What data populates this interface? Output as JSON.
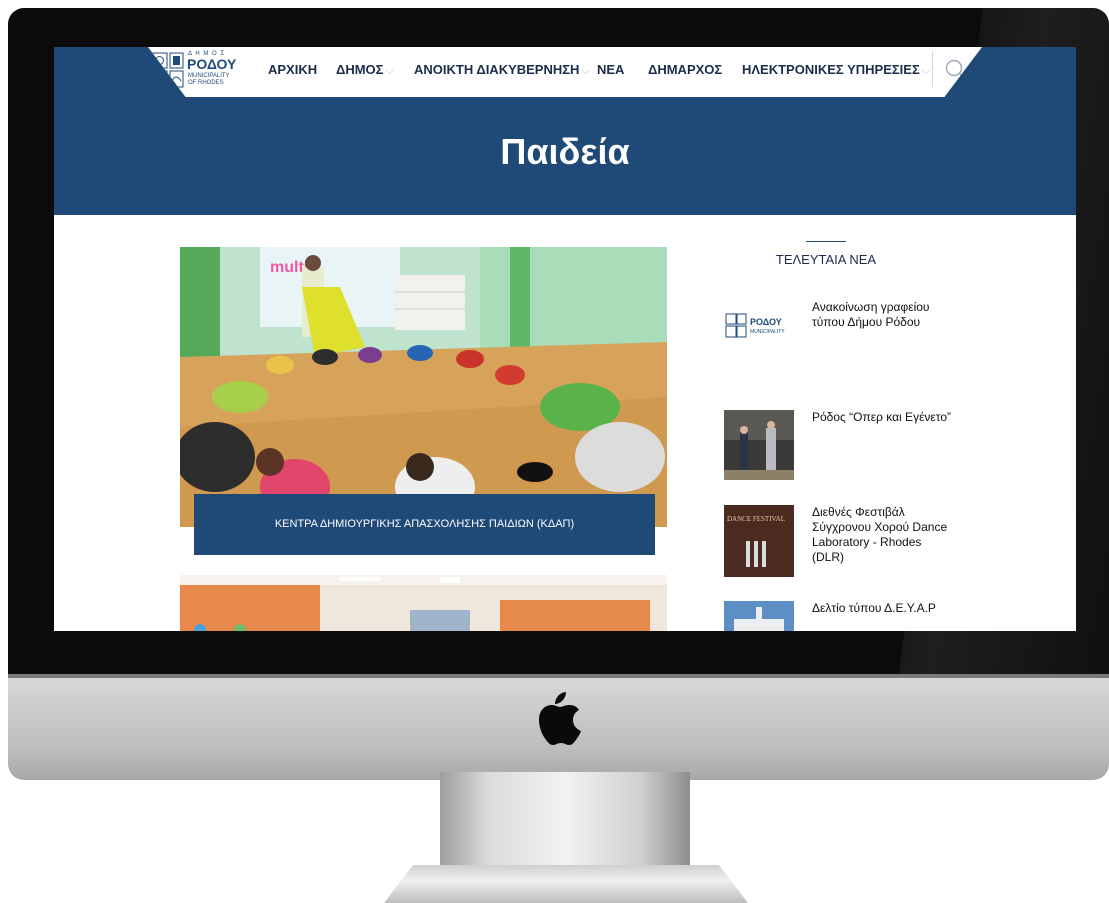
{
  "site": {
    "logo": {
      "line1": "Δ Η Μ Ο Σ",
      "line2": "ΡΟΔΟΥ",
      "line3": "MUNICIPALITY",
      "line4": "OF RHODES"
    },
    "nav": [
      {
        "label": "ΑΡΧΙΚΗ",
        "has_dropdown": false
      },
      {
        "label": "ΔΗΜΟΣ",
        "has_dropdown": true
      },
      {
        "label": "ΑΝΟΙΚΤΗ ΔΙΑΚΥΒΕΡΝΗΣΗ",
        "has_dropdown": true
      },
      {
        "label": "ΝΕΑ",
        "has_dropdown": false
      },
      {
        "label": "ΔΗΜΑΡΧΟΣ",
        "has_dropdown": false
      },
      {
        "label": "ΗΛΕΚΤΡΟΝΙΚΕΣ ΥΠΗΡΕΣΙΕΣ",
        "has_dropdown": true
      }
    ],
    "search_icon": "search-icon",
    "dropdown_icon": "chevron-down-icon"
  },
  "page": {
    "title": "Παιδεία"
  },
  "articles": [
    {
      "caption": "ΚΕΝΤΡΑ ΔΗΜΙΟΥΡΓΙΚΗΣ ΑΠΑΣΧΟΛΗΣΗΣ ΠΑΙΔΙΩΝ (ΚΔΑΠ)",
      "image_text": "multis"
    }
  ],
  "sidebar": {
    "heading": "ΤΕΛΕΥΤΑΙΑ ΝΕΑ",
    "news": [
      {
        "title": "Ανακοίνωση γραφείου τύπου Δήμου Ρόδου"
      },
      {
        "title": "Ρόδος “Οπερ και Εγένετο”"
      },
      {
        "title": "Διεθνές Φεστιβάλ Σύγχρονου Χορού Dance Laboratory - Rhodes (DLR)",
        "image_text": "DANCE FESTIVAL"
      },
      {
        "title": "Δελτίο τύπου Δ.Ε.Υ.Α.Ρ"
      }
    ]
  },
  "device": {
    "brand_icon": "apple-logo-icon"
  },
  "colors": {
    "brand_blue": "#1f4a78",
    "nav_text": "#1c2d4a",
    "white": "#ffffff"
  }
}
